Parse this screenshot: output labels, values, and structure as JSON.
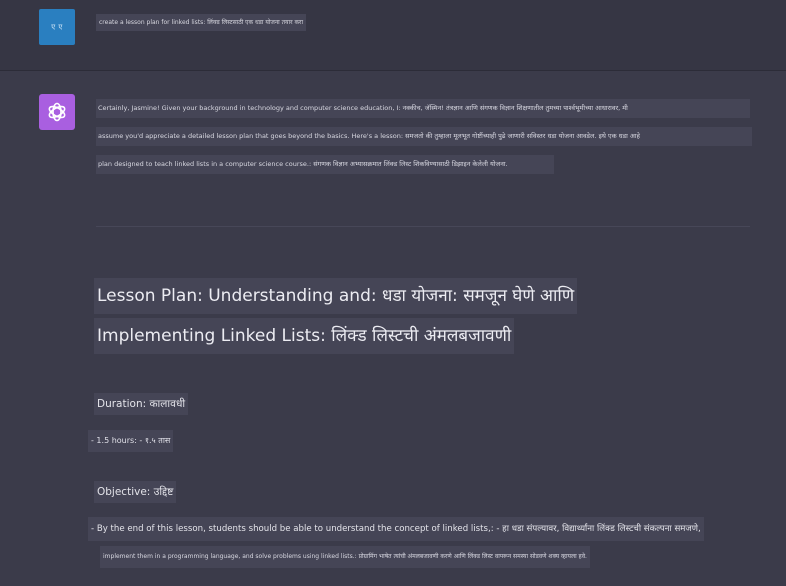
{
  "user_message": {
    "avatar_label": "ए ए",
    "text": "create a lesson plan for linked lists: लिंक्ड लिस्टसाठी एक धडा योजना तयार करा"
  },
  "assistant_message": {
    "avatar_icon": "openai-logo-icon",
    "intro_lines": [
      "Certainly, Jasmine! Given your background in technology and computer science education, I: नक्कीच, जॅस्मिन! तंत्रज्ञान आणि संगणक विज्ञान शिक्षणातील तुमच्या पार्श्वभूमीच्या आधारावर, मी",
      "assume you'd appreciate a detailed lesson plan that goes beyond the basics. Here's a lesson: समजतो की तुम्हाला मूलभूत गोष्टींच्याही पुढे जाणारी सविस्तर धडा योजना आवडेल. इथे एक धडा आहे",
      "plan designed to teach linked lists in a computer science course.: संगणक विज्ञान अभ्यासक्रमात लिंक्ड लिस्ट शिकविण्यासाठी डिझाइन केलेली योजना."
    ],
    "heading_line1": "Lesson Plan: Understanding and: धडा योजना: समजून घेणे आणि",
    "heading_line2": "Implementing Linked Lists: लिंक्ड लिस्टची अंमलबजावणी",
    "duration_label": "Duration: कालावधी",
    "duration_value": "- 1.5 hours: - १.५ तास",
    "objective_label": "Objective: उद्दिष्ट",
    "objective_line1": "- By the end of this lesson, students should be able to understand the concept of linked lists,: - हा धडा संपल्यावर, विद्यार्थ्यांना लिंक्ड लिस्टची संकल्पना समजणे,",
    "objective_line2": "implement them in a programming language, and solve problems using linked lists.: प्रोग्रामिंग भाषेत त्यांची अंमलबजावणी करणे आणि लिंक्ड लिस्ट वापरून समस्या सोडवणे शक्य व्हायला हवे."
  }
}
